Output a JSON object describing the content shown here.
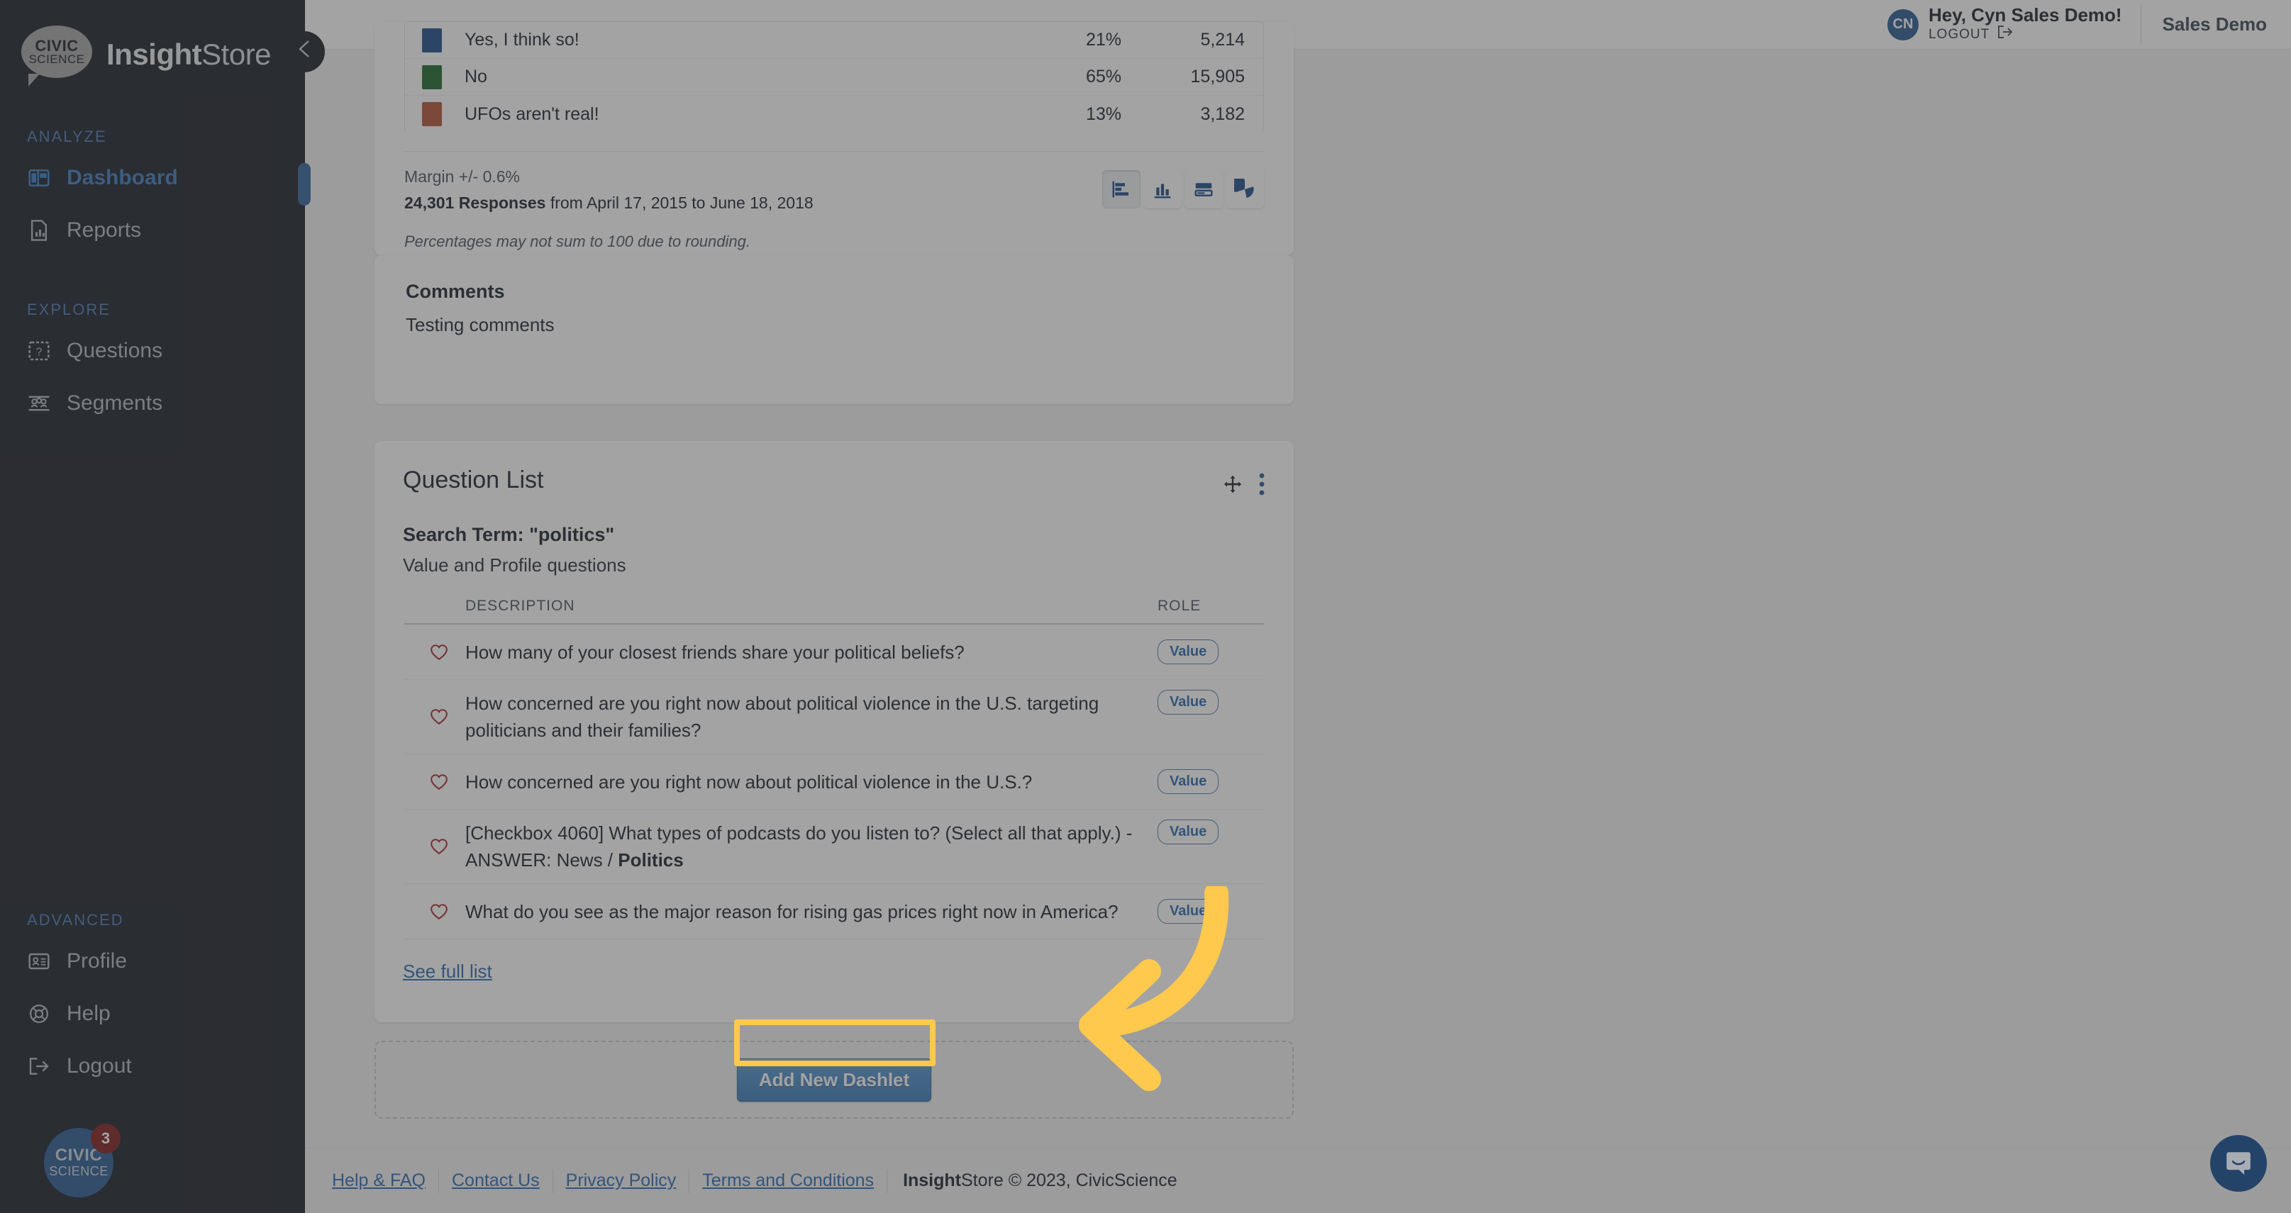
{
  "brand": {
    "logo_line1": "CIVIC",
    "logo_line2": "SCIENCE",
    "name_bold": "Insight",
    "name_rest": "Store"
  },
  "sidebar": {
    "groups": [
      {
        "label": "ANALYZE",
        "items": [
          {
            "label": "Dashboard",
            "icon": "dashboard-icon",
            "active": true
          },
          {
            "label": "Reports",
            "icon": "report-icon",
            "active": false
          }
        ]
      },
      {
        "label": "EXPLORE",
        "items": [
          {
            "label": "Questions",
            "icon": "question-icon",
            "active": false
          },
          {
            "label": "Segments",
            "icon": "segments-icon",
            "active": false
          }
        ]
      },
      {
        "label": "ADVANCED",
        "items": [
          {
            "label": "Profile",
            "icon": "profile-card-icon",
            "active": false
          },
          {
            "label": "Help",
            "icon": "lifebuoy-icon",
            "active": false
          },
          {
            "label": "Logout",
            "icon": "logout-icon",
            "active": false
          }
        ]
      }
    ],
    "collapse_icon": "chevron-left-icon",
    "badge": {
      "line1": "CIVIC",
      "line2": "SCIENCE",
      "count": "3"
    }
  },
  "topbar": {
    "avatar_initials": "CN",
    "greeting": "Hey, Cyn Sales Demo!",
    "logout_label": "LOGOUT",
    "account_name": "Sales Demo"
  },
  "results": {
    "rows": [
      {
        "label": "Yes, I think so!",
        "pct": "21%",
        "count": "5,214",
        "color": "#1f4e8c"
      },
      {
        "label": "No",
        "pct": "65%",
        "count": "15,905",
        "color": "#1f6b2e"
      },
      {
        "label": "UFOs aren't real!",
        "pct": "13%",
        "count": "3,182",
        "color": "#b4543a"
      }
    ],
    "margin": "Margin +/- 0.6%",
    "responses_count": "24,301 Responses",
    "responses_range": " from April 17, 2015 to June 18, 2018",
    "rounding_note": "Percentages may not sum to 100 due to rounding.",
    "chart_toggles": [
      {
        "icon": "horizontal-bar-chart-icon",
        "active": true
      },
      {
        "icon": "vertical-bar-chart-icon",
        "active": false
      },
      {
        "icon": "stacked-bar-chart-icon",
        "active": false
      },
      {
        "icon": "pie-chart-icon",
        "active": false
      }
    ]
  },
  "comments": {
    "title": "Comments",
    "body": "Testing comments"
  },
  "question_list": {
    "title": "Question List",
    "move_icon": "move-icon",
    "menu_icon": "kebab-menu-icon",
    "search_term": "Search Term: \"politics\"",
    "subtitle": "Value and Profile questions",
    "columns": {
      "description": "DESCRIPTION",
      "role": "ROLE"
    },
    "rows": [
      {
        "heart": "heart-icon",
        "description": "How many of your closest friends share your political beliefs?",
        "bold_tail": "",
        "role": "Value"
      },
      {
        "heart": "heart-icon",
        "description": "How concerned are you right now about political violence in the U.S. targeting politicians and their families?",
        "bold_tail": "",
        "role": "Value"
      },
      {
        "heart": "heart-icon",
        "description": "How concerned are you right now about political violence in the U.S.?",
        "bold_tail": "",
        "role": "Value"
      },
      {
        "heart": "heart-icon",
        "description": "[Checkbox 4060] What types of podcasts do you listen to? (Select all that apply.) - ANSWER: News / ",
        "bold_tail": "Politics",
        "role": "Value"
      },
      {
        "heart": "heart-icon",
        "description": "What do you see as the major reason for rising gas prices right now in America?",
        "bold_tail": "",
        "role": "Value"
      }
    ],
    "see_full_list": "See full list"
  },
  "add_dashlet": {
    "label": "Add New Dashlet"
  },
  "annotation": {
    "highlight_color": "#ffc94d",
    "arrow_color": "#ffc94d"
  },
  "footer": {
    "links": [
      "Help & FAQ",
      "Contact Us",
      "Privacy Policy",
      "Terms and Conditions"
    ],
    "copy_bold": "Insight",
    "copy_rest": "Store © 2023, CivicScience"
  },
  "chat": {
    "icon": "chat-bubble-icon"
  }
}
